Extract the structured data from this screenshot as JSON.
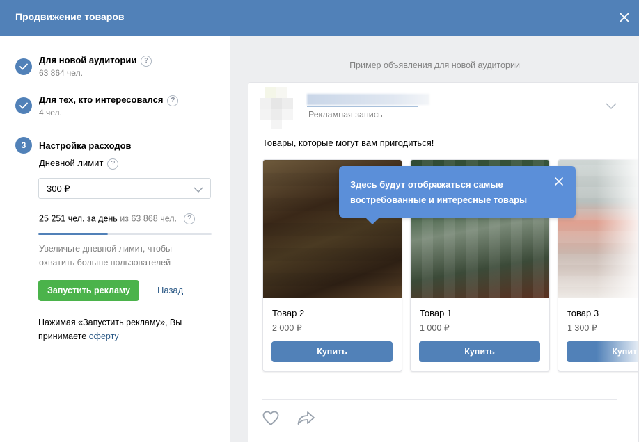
{
  "header": {
    "title": "Продвижение товаров"
  },
  "steps": [
    {
      "title": "Для новой аудитории",
      "subtitle": "63 864 чел.",
      "state": "done"
    },
    {
      "title": "Для тех, кто интересовался",
      "subtitle": "4 чел.",
      "state": "done"
    },
    {
      "number": "3",
      "title": "Настройка расходов",
      "state": "active"
    }
  ],
  "budget": {
    "label": "Дневной лимит",
    "selected": "300 ₽",
    "reach_prefix": "25 251 чел. за день",
    "reach_suffix": "из 63 868 чел.",
    "reach_fraction": 0.4,
    "hint": "Увеличьте дневной лимит, чтобы охватить больше пользователей"
  },
  "actions": {
    "launch": "Запустить рекламу",
    "back": "Назад"
  },
  "terms": {
    "text": "Нажимая «Запустить рекламу», Вы принимаете",
    "link": "оферту"
  },
  "preview": {
    "label": "Пример объявления для новой аудитории",
    "ad_label": "Рекламная запись",
    "text": "Товары, которые могут вам пригодиться!",
    "tooltip": "Здесь будут отображаться самые востребованные и интересные товары",
    "products": [
      {
        "name": "Товар 2",
        "price": "2 000 ₽",
        "buy": "Купить"
      },
      {
        "name": "Товар 1",
        "price": "1 000 ₽",
        "buy": "Купить"
      },
      {
        "name": "товар 3",
        "price": "1 300 ₽",
        "buy": "Купить"
      }
    ]
  },
  "colors": {
    "header": "#5181b8",
    "accent": "#5181b8",
    "launch": "#4bb34b",
    "tooltip": "#5b8fd9"
  }
}
